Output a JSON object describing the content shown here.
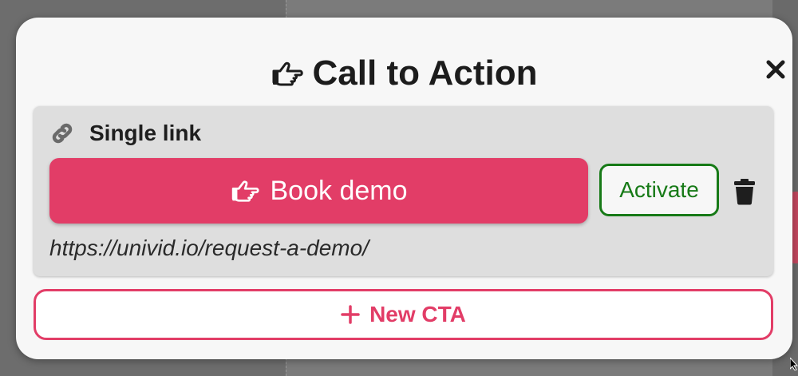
{
  "modal": {
    "title": "Call to Action",
    "title_icon": "hand-pointing-right-icon",
    "close_icon": "close-icon"
  },
  "cta_card": {
    "type_icon": "link-icon",
    "type_label": "Single link",
    "button_label": "Book demo",
    "button_icon": "hand-pointing-right-icon",
    "activate_label": "Activate",
    "delete_icon": "trash-icon",
    "url": "https://univid.io/request-a-demo/"
  },
  "new_cta": {
    "icon": "plus-icon",
    "label": "New CTA"
  },
  "colors": {
    "accent": "#e23d67",
    "activate": "#177a17",
    "card_bg": "#dedede",
    "modal_bg": "#f7f7f7"
  }
}
